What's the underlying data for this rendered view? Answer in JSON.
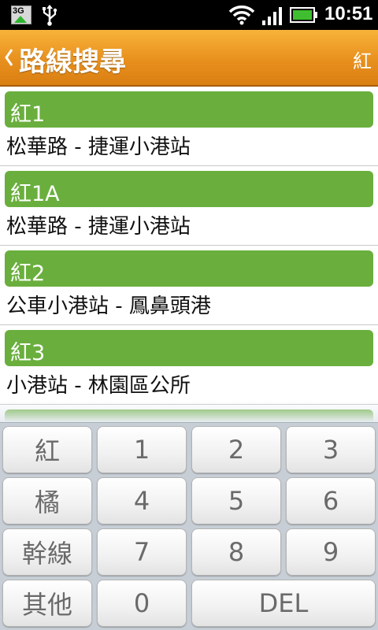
{
  "status_bar": {
    "network_badge": "3G",
    "time": "10:51",
    "icons": [
      "3g-data-icon",
      "usb-icon",
      "wifi-icon",
      "signal-icon",
      "battery-icon"
    ]
  },
  "header": {
    "title": "路線搜尋",
    "filter_label": "紅",
    "back_icon": "chevron-left-icon"
  },
  "routes": [
    {
      "number": "紅1",
      "description": "松華路 - 捷運小港站"
    },
    {
      "number": "紅1A",
      "description": "松華路 - 捷運小港站"
    },
    {
      "number": "紅2",
      "description": "公車小港站 - 鳳鼻頭港"
    },
    {
      "number": "紅3",
      "description": "小港站 - 林園區公所"
    }
  ],
  "keypad": {
    "rows": [
      [
        "紅",
        "1",
        "2",
        "3"
      ],
      [
        "橘",
        "4",
        "5",
        "6"
      ],
      [
        "幹線",
        "7",
        "8",
        "9"
      ],
      [
        "其他",
        "0",
        "DEL"
      ]
    ]
  },
  "colors": {
    "header_orange": "#e8901e",
    "route_green": "#6aaf3d",
    "keypad_bg": "#c7ced6"
  }
}
